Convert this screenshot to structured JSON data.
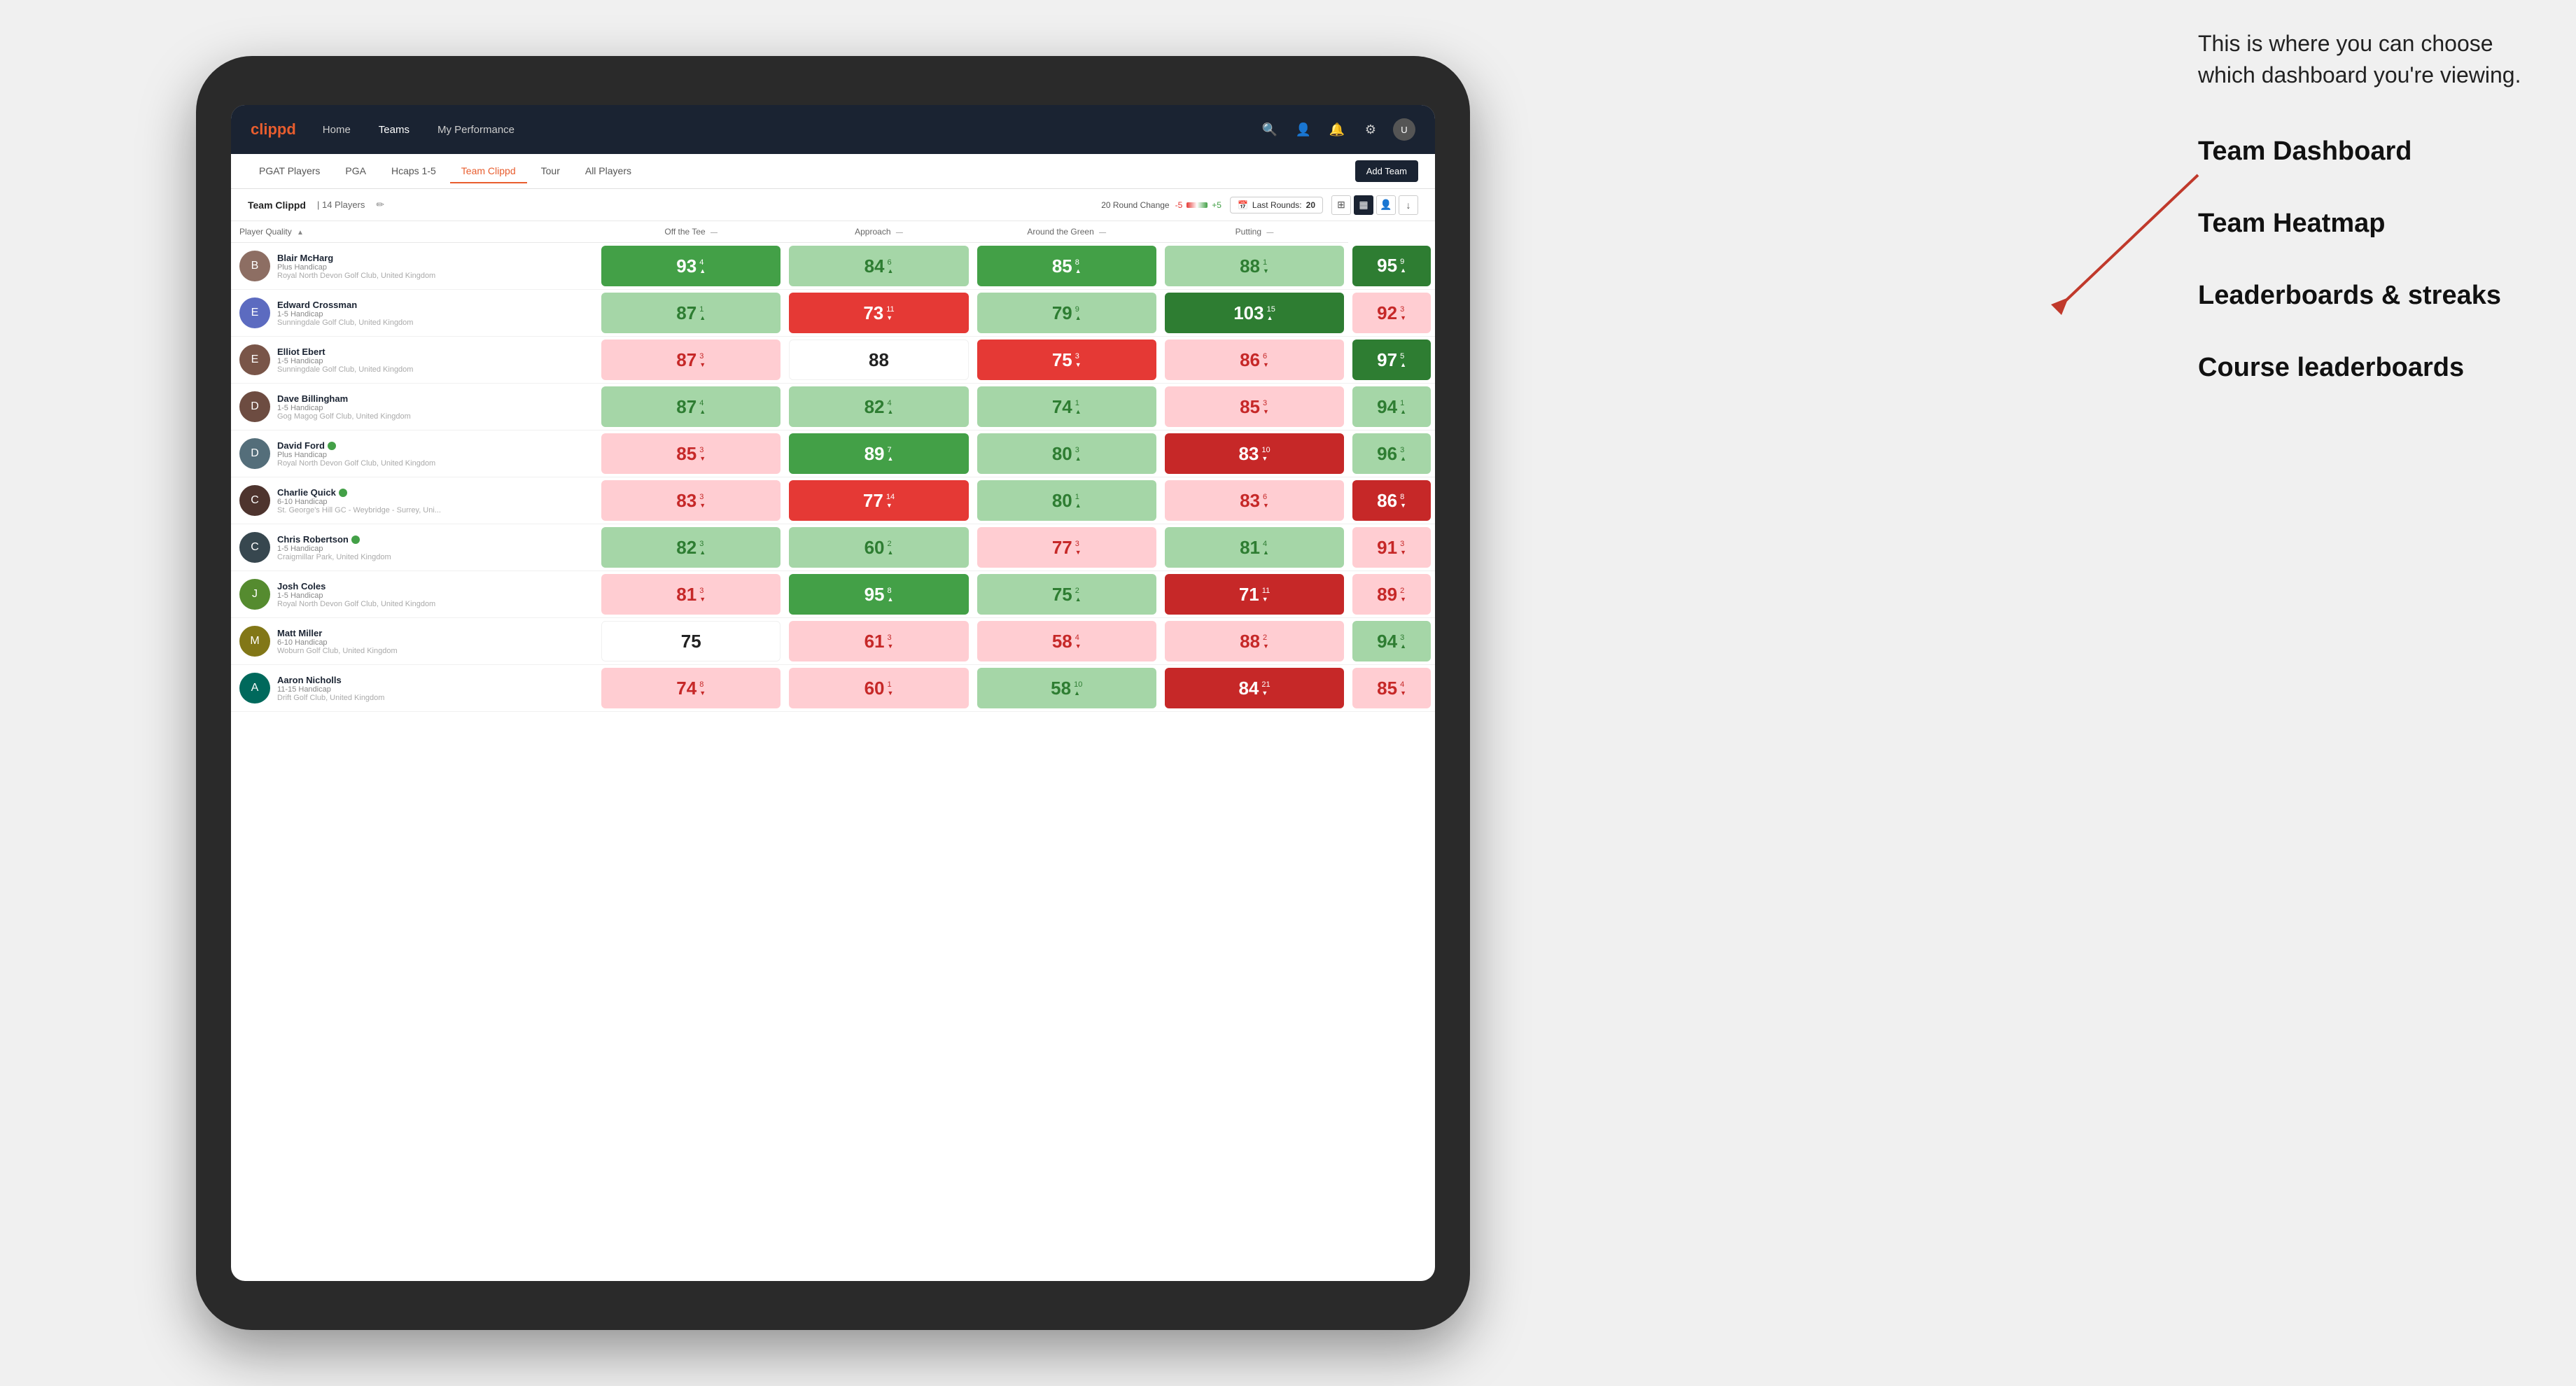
{
  "annotation": {
    "intro": "This is where you can choose which dashboard you're viewing.",
    "options": [
      {
        "id": "team-dashboard",
        "label": "Team Dashboard"
      },
      {
        "id": "team-heatmap",
        "label": "Team Heatmap"
      },
      {
        "id": "leaderboards",
        "label": "Leaderboards & streaks"
      },
      {
        "id": "course-leaderboards",
        "label": "Course leaderboards"
      }
    ]
  },
  "navbar": {
    "logo": "clippd",
    "nav_items": [
      {
        "id": "home",
        "label": "Home",
        "active": false
      },
      {
        "id": "teams",
        "label": "Teams",
        "active": true
      },
      {
        "id": "my-performance",
        "label": "My Performance",
        "active": false
      }
    ]
  },
  "subnav": {
    "tabs": [
      {
        "id": "pgat-players",
        "label": "PGAT Players",
        "active": false
      },
      {
        "id": "pga",
        "label": "PGA",
        "active": false
      },
      {
        "id": "hcaps-1-5",
        "label": "Hcaps 1-5",
        "active": false
      },
      {
        "id": "team-clippd",
        "label": "Team Clippd",
        "active": true
      },
      {
        "id": "tour",
        "label": "Tour",
        "active": false
      },
      {
        "id": "all-players",
        "label": "All Players",
        "active": false
      }
    ],
    "add_team_label": "Add Team"
  },
  "team_bar": {
    "team_name": "Team Clippd",
    "separator": "|",
    "player_count": "14 Players",
    "round_change_label": "20 Round Change",
    "round_change_neg": "-5",
    "round_change_pos": "+5",
    "last_rounds_label": "Last Rounds:",
    "last_rounds_value": "20"
  },
  "table": {
    "columns": [
      {
        "id": "player",
        "label": "Player Quality",
        "has_arrow": true
      },
      {
        "id": "off-tee",
        "label": "Off the Tee",
        "has_arrow": true
      },
      {
        "id": "approach",
        "label": "Approach",
        "has_arrow": true
      },
      {
        "id": "around-green",
        "label": "Around the Green",
        "has_arrow": true
      },
      {
        "id": "putting",
        "label": "Putting",
        "has_arrow": true
      }
    ],
    "players": [
      {
        "id": "blair-mcharg",
        "name": "Blair McHarg",
        "handicap": "Plus Handicap",
        "club": "Royal North Devon Golf Club, United Kingdom",
        "verified": false,
        "avatar_initial": "B",
        "avatar_color": "#8d6e63",
        "scores": [
          {
            "value": 93,
            "change": 4,
            "direction": "up",
            "color": "green-med"
          },
          {
            "value": 84,
            "change": 6,
            "direction": "up",
            "color": "green-light"
          },
          {
            "value": 85,
            "change": 8,
            "direction": "up",
            "color": "green-med"
          },
          {
            "value": 88,
            "change": 1,
            "direction": "down",
            "color": "green-light"
          },
          {
            "value": 95,
            "change": 9,
            "direction": "up",
            "color": "green-dark"
          }
        ]
      },
      {
        "id": "edward-crossman",
        "name": "Edward Crossman",
        "handicap": "1-5 Handicap",
        "club": "Sunningdale Golf Club, United Kingdom",
        "verified": false,
        "avatar_initial": "E",
        "avatar_color": "#5c6bc0",
        "scores": [
          {
            "value": 87,
            "change": 1,
            "direction": "up",
            "color": "green-light"
          },
          {
            "value": 73,
            "change": 11,
            "direction": "down",
            "color": "red-med"
          },
          {
            "value": 79,
            "change": 9,
            "direction": "up",
            "color": "green-light"
          },
          {
            "value": 103,
            "change": 15,
            "direction": "up",
            "color": "green-dark"
          },
          {
            "value": 92,
            "change": 3,
            "direction": "down",
            "color": "red-light"
          }
        ]
      },
      {
        "id": "elliot-ebert",
        "name": "Elliot Ebert",
        "handicap": "1-5 Handicap",
        "club": "Sunningdale Golf Club, United Kingdom",
        "verified": false,
        "avatar_initial": "E",
        "avatar_color": "#795548",
        "scores": [
          {
            "value": 87,
            "change": 3,
            "direction": "down",
            "color": "red-light"
          },
          {
            "value": 88,
            "change": null,
            "direction": null,
            "color": "white-bg"
          },
          {
            "value": 75,
            "change": 3,
            "direction": "down",
            "color": "red-med"
          },
          {
            "value": 86,
            "change": 6,
            "direction": "down",
            "color": "red-light"
          },
          {
            "value": 97,
            "change": 5,
            "direction": "up",
            "color": "green-dark"
          }
        ]
      },
      {
        "id": "dave-billingham",
        "name": "Dave Billingham",
        "handicap": "1-5 Handicap",
        "club": "Gog Magog Golf Club, United Kingdom",
        "verified": false,
        "avatar_initial": "D",
        "avatar_color": "#6d4c41",
        "scores": [
          {
            "value": 87,
            "change": 4,
            "direction": "up",
            "color": "green-light"
          },
          {
            "value": 82,
            "change": 4,
            "direction": "up",
            "color": "green-light"
          },
          {
            "value": 74,
            "change": 1,
            "direction": "up",
            "color": "green-light"
          },
          {
            "value": 85,
            "change": 3,
            "direction": "down",
            "color": "red-light"
          },
          {
            "value": 94,
            "change": 1,
            "direction": "up",
            "color": "green-light"
          }
        ]
      },
      {
        "id": "david-ford",
        "name": "David Ford",
        "handicap": "Plus Handicap",
        "club": "Royal North Devon Golf Club, United Kingdom",
        "verified": true,
        "avatar_initial": "D",
        "avatar_color": "#546e7a",
        "scores": [
          {
            "value": 85,
            "change": 3,
            "direction": "down",
            "color": "red-light"
          },
          {
            "value": 89,
            "change": 7,
            "direction": "up",
            "color": "green-med"
          },
          {
            "value": 80,
            "change": 3,
            "direction": "up",
            "color": "green-light"
          },
          {
            "value": 83,
            "change": 10,
            "direction": "down",
            "color": "red-dark"
          },
          {
            "value": 96,
            "change": 3,
            "direction": "up",
            "color": "green-light"
          }
        ]
      },
      {
        "id": "charlie-quick",
        "name": "Charlie Quick",
        "handicap": "6-10 Handicap",
        "club": "St. George's Hill GC - Weybridge - Surrey, Uni...",
        "verified": true,
        "avatar_initial": "C",
        "avatar_color": "#4e342e",
        "scores": [
          {
            "value": 83,
            "change": 3,
            "direction": "down",
            "color": "red-light"
          },
          {
            "value": 77,
            "change": 14,
            "direction": "down",
            "color": "red-med"
          },
          {
            "value": 80,
            "change": 1,
            "direction": "up",
            "color": "green-light"
          },
          {
            "value": 83,
            "change": 6,
            "direction": "down",
            "color": "red-light"
          },
          {
            "value": 86,
            "change": 8,
            "direction": "down",
            "color": "red-dark"
          }
        ]
      },
      {
        "id": "chris-robertson",
        "name": "Chris Robertson",
        "handicap": "1-5 Handicap",
        "club": "Craigmillar Park, United Kingdom",
        "verified": true,
        "avatar_initial": "C",
        "avatar_color": "#37474f",
        "scores": [
          {
            "value": 82,
            "change": 3,
            "direction": "up",
            "color": "green-light"
          },
          {
            "value": 60,
            "change": 2,
            "direction": "up",
            "color": "green-light"
          },
          {
            "value": 77,
            "change": 3,
            "direction": "down",
            "color": "red-light"
          },
          {
            "value": 81,
            "change": 4,
            "direction": "up",
            "color": "green-light"
          },
          {
            "value": 91,
            "change": 3,
            "direction": "down",
            "color": "red-light"
          }
        ]
      },
      {
        "id": "josh-coles",
        "name": "Josh Coles",
        "handicap": "1-5 Handicap",
        "club": "Royal North Devon Golf Club, United Kingdom",
        "verified": false,
        "avatar_initial": "J",
        "avatar_color": "#558b2f",
        "scores": [
          {
            "value": 81,
            "change": 3,
            "direction": "down",
            "color": "red-light"
          },
          {
            "value": 95,
            "change": 8,
            "direction": "up",
            "color": "green-med"
          },
          {
            "value": 75,
            "change": 2,
            "direction": "up",
            "color": "green-light"
          },
          {
            "value": 71,
            "change": 11,
            "direction": "down",
            "color": "red-dark"
          },
          {
            "value": 89,
            "change": 2,
            "direction": "down",
            "color": "red-light"
          }
        ]
      },
      {
        "id": "matt-miller",
        "name": "Matt Miller",
        "handicap": "6-10 Handicap",
        "club": "Woburn Golf Club, United Kingdom",
        "verified": false,
        "avatar_initial": "M",
        "avatar_color": "#827717",
        "scores": [
          {
            "value": 75,
            "change": null,
            "direction": null,
            "color": "white-bg"
          },
          {
            "value": 61,
            "change": 3,
            "direction": "down",
            "color": "red-light"
          },
          {
            "value": 58,
            "change": 4,
            "direction": "down",
            "color": "red-light"
          },
          {
            "value": 88,
            "change": 2,
            "direction": "down",
            "color": "red-light"
          },
          {
            "value": 94,
            "change": 3,
            "direction": "up",
            "color": "green-light"
          }
        ]
      },
      {
        "id": "aaron-nicholls",
        "name": "Aaron Nicholls",
        "handicap": "11-15 Handicap",
        "club": "Drift Golf Club, United Kingdom",
        "verified": false,
        "avatar_initial": "A",
        "avatar_color": "#00695c",
        "scores": [
          {
            "value": 74,
            "change": 8,
            "direction": "down",
            "color": "red-light"
          },
          {
            "value": 60,
            "change": 1,
            "direction": "down",
            "color": "red-light"
          },
          {
            "value": 58,
            "change": 10,
            "direction": "up",
            "color": "green-light"
          },
          {
            "value": 84,
            "change": 21,
            "direction": "down",
            "color": "red-dark"
          },
          {
            "value": 85,
            "change": 4,
            "direction": "down",
            "color": "red-light"
          }
        ]
      }
    ]
  }
}
